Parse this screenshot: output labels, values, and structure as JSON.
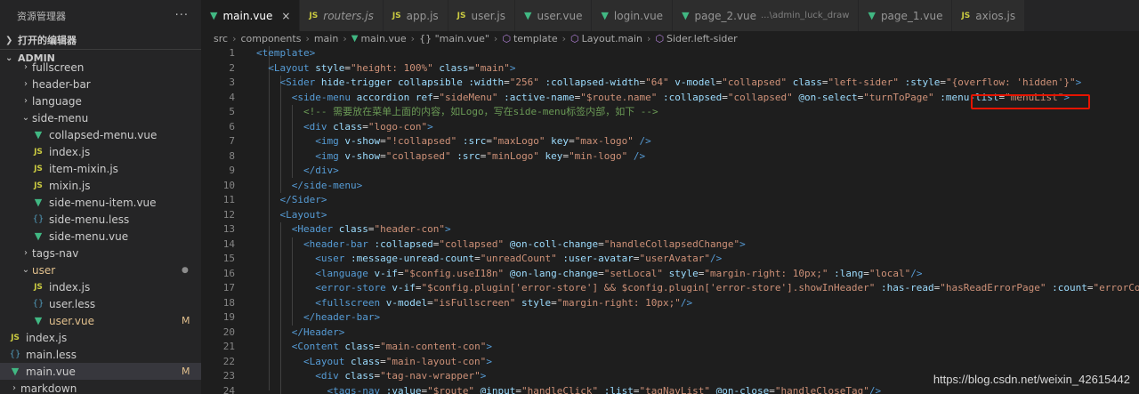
{
  "sidebar": {
    "title": "资源管理器",
    "more": "···",
    "open_editors": "打开的编辑器",
    "workspace": "ADMIN",
    "tree": [
      {
        "label": "fullscreen",
        "type": "folder",
        "depth": 2
      },
      {
        "label": "header-bar",
        "type": "folder",
        "depth": 2
      },
      {
        "label": "language",
        "type": "folder",
        "depth": 2
      },
      {
        "label": "side-menu",
        "type": "folder-open",
        "depth": 2
      },
      {
        "label": "collapsed-menu.vue",
        "type": "vue",
        "depth": 3
      },
      {
        "label": "index.js",
        "type": "js",
        "depth": 3
      },
      {
        "label": "item-mixin.js",
        "type": "js",
        "depth": 3
      },
      {
        "label": "mixin.js",
        "type": "js",
        "depth": 3
      },
      {
        "label": "side-menu-item.vue",
        "type": "vue",
        "depth": 3
      },
      {
        "label": "side-menu.less",
        "type": "less",
        "depth": 3
      },
      {
        "label": "side-menu.vue",
        "type": "vue",
        "depth": 3
      },
      {
        "label": "tags-nav",
        "type": "folder",
        "depth": 2
      },
      {
        "label": "user",
        "type": "folder-open",
        "depth": 2,
        "modified": true,
        "dot": "●"
      },
      {
        "label": "index.js",
        "type": "js",
        "depth": 3
      },
      {
        "label": "user.less",
        "type": "less",
        "depth": 3
      },
      {
        "label": "user.vue",
        "type": "vue",
        "depth": 3,
        "modified": true,
        "badge": "M"
      },
      {
        "label": "index.js",
        "type": "js",
        "depth": 1
      },
      {
        "label": "main.less",
        "type": "less",
        "depth": 1
      },
      {
        "label": "main.vue",
        "type": "vue",
        "depth": 1,
        "active": true,
        "badge": "M"
      },
      {
        "label": "markdown",
        "type": "folder",
        "depth": 1
      }
    ]
  },
  "tabs": [
    {
      "label": "main.vue",
      "icon": "vue",
      "active": true,
      "close": "×"
    },
    {
      "label": "routers.js",
      "icon": "js",
      "italic": true
    },
    {
      "label": "app.js",
      "icon": "js"
    },
    {
      "label": "user.js",
      "icon": "js"
    },
    {
      "label": "user.vue",
      "icon": "vue"
    },
    {
      "label": "login.vue",
      "icon": "vue"
    },
    {
      "label": "page_2.vue",
      "icon": "vue",
      "desc": "...\\admin_luck_draw"
    },
    {
      "label": "page_1.vue",
      "icon": "vue"
    },
    {
      "label": "axios.js",
      "icon": "js"
    }
  ],
  "breadcrumb": [
    "src",
    "components",
    "main",
    "main.vue",
    "{} \"main.vue\"",
    "template",
    "Layout.main",
    "Sider.left-sider"
  ],
  "code_lines": [
    [
      [
        "t",
        "<template>"
      ]
    ],
    [
      [
        "e",
        "  "
      ],
      [
        "t",
        "<Layout"
      ],
      [
        "a",
        " style"
      ],
      [
        "e",
        "="
      ],
      [
        "s",
        "\"height: 100%\""
      ],
      [
        "a",
        " class"
      ],
      [
        "e",
        "="
      ],
      [
        "s",
        "\"main\""
      ],
      [
        "t",
        ">"
      ]
    ],
    [
      [
        "e",
        "    "
      ],
      [
        "t",
        "<Sider"
      ],
      [
        "a",
        " hide-trigger collapsible :width"
      ],
      [
        "e",
        "="
      ],
      [
        "s",
        "\"256\""
      ],
      [
        "a",
        " :collapsed-width"
      ],
      [
        "e",
        "="
      ],
      [
        "s",
        "\"64\""
      ],
      [
        "a",
        " v-model"
      ],
      [
        "e",
        "="
      ],
      [
        "s",
        "\"collapsed\""
      ],
      [
        "a",
        " class"
      ],
      [
        "e",
        "="
      ],
      [
        "s",
        "\"left-sider\""
      ],
      [
        "a",
        " :style"
      ],
      [
        "e",
        "="
      ],
      [
        "s",
        "\"{overflow: 'hidden'}\""
      ],
      [
        "t",
        ">"
      ]
    ],
    [
      [
        "e",
        "      "
      ],
      [
        "t",
        "<side-menu"
      ],
      [
        "a",
        " accordion ref"
      ],
      [
        "e",
        "="
      ],
      [
        "s",
        "\"sideMenu\""
      ],
      [
        "a",
        " :active-name"
      ],
      [
        "e",
        "="
      ],
      [
        "s",
        "\"$route.name\""
      ],
      [
        "a",
        " :collapsed"
      ],
      [
        "e",
        "="
      ],
      [
        "s",
        "\"collapsed\""
      ],
      [
        "a",
        " @on-select"
      ],
      [
        "e",
        "="
      ],
      [
        "s",
        "\"turnToPage\""
      ],
      [
        "a",
        " :menu-list"
      ],
      [
        "e",
        "="
      ],
      [
        "s",
        "\"menuList\""
      ],
      [
        "t",
        ">"
      ]
    ],
    [
      [
        "e",
        "        "
      ],
      [
        "c",
        "<!-- 需要放在菜单上面的内容，如Logo，写在side-menu标签内部，如下 -->"
      ]
    ],
    [
      [
        "e",
        "        "
      ],
      [
        "t",
        "<div"
      ],
      [
        "a",
        " class"
      ],
      [
        "e",
        "="
      ],
      [
        "s",
        "\"logo-con\""
      ],
      [
        "t",
        ">"
      ]
    ],
    [
      [
        "e",
        "          "
      ],
      [
        "t",
        "<img"
      ],
      [
        "a",
        " v-show"
      ],
      [
        "e",
        "="
      ],
      [
        "s",
        "\"!collapsed\""
      ],
      [
        "a",
        " :src"
      ],
      [
        "e",
        "="
      ],
      [
        "s",
        "\"maxLogo\""
      ],
      [
        "a",
        " key"
      ],
      [
        "e",
        "="
      ],
      [
        "s",
        "\"max-logo\""
      ],
      [
        "t",
        " />"
      ]
    ],
    [
      [
        "e",
        "          "
      ],
      [
        "t",
        "<img"
      ],
      [
        "a",
        " v-show"
      ],
      [
        "e",
        "="
      ],
      [
        "s",
        "\"collapsed\""
      ],
      [
        "a",
        " :src"
      ],
      [
        "e",
        "="
      ],
      [
        "s",
        "\"minLogo\""
      ],
      [
        "a",
        " key"
      ],
      [
        "e",
        "="
      ],
      [
        "s",
        "\"min-logo\""
      ],
      [
        "t",
        " />"
      ]
    ],
    [
      [
        "e",
        "        "
      ],
      [
        "t",
        "</div>"
      ]
    ],
    [
      [
        "e",
        "      "
      ],
      [
        "t",
        "</side-menu>"
      ]
    ],
    [
      [
        "e",
        "    "
      ],
      [
        "t",
        "</Sider>"
      ]
    ],
    [
      [
        "e",
        "    "
      ],
      [
        "t",
        "<Layout>"
      ]
    ],
    [
      [
        "e",
        "      "
      ],
      [
        "t",
        "<Header"
      ],
      [
        "a",
        " class"
      ],
      [
        "e",
        "="
      ],
      [
        "s",
        "\"header-con\""
      ],
      [
        "t",
        ">"
      ]
    ],
    [
      [
        "e",
        "        "
      ],
      [
        "t",
        "<header-bar"
      ],
      [
        "a",
        " :collapsed"
      ],
      [
        "e",
        "="
      ],
      [
        "s",
        "\"collapsed\""
      ],
      [
        "a",
        " @on-coll-change"
      ],
      [
        "e",
        "="
      ],
      [
        "s",
        "\"handleCollapsedChange\""
      ],
      [
        "t",
        ">"
      ]
    ],
    [
      [
        "e",
        "          "
      ],
      [
        "t",
        "<user"
      ],
      [
        "a",
        " :message-unread-count"
      ],
      [
        "e",
        "="
      ],
      [
        "s",
        "\"unreadCount\""
      ],
      [
        "a",
        " :user-avatar"
      ],
      [
        "e",
        "="
      ],
      [
        "s",
        "\"userAvatar\""
      ],
      [
        "t",
        "/>"
      ]
    ],
    [
      [
        "e",
        "          "
      ],
      [
        "t",
        "<language"
      ],
      [
        "a",
        " v-if"
      ],
      [
        "e",
        "="
      ],
      [
        "s",
        "\"$config.useI18n\""
      ],
      [
        "a",
        " @on-lang-change"
      ],
      [
        "e",
        "="
      ],
      [
        "s",
        "\"setLocal\""
      ],
      [
        "a",
        " style"
      ],
      [
        "e",
        "="
      ],
      [
        "s",
        "\"margin-right: 10px;\""
      ],
      [
        "a",
        " :lang"
      ],
      [
        "e",
        "="
      ],
      [
        "s",
        "\"local\""
      ],
      [
        "t",
        "/>"
      ]
    ],
    [
      [
        "e",
        "          "
      ],
      [
        "t",
        "<error-store"
      ],
      [
        "a",
        " v-if"
      ],
      [
        "e",
        "="
      ],
      [
        "s",
        "\"$config.plugin['error-store'] && $config.plugin['error-store'].showInHeader\""
      ],
      [
        "a",
        " :has-read"
      ],
      [
        "e",
        "="
      ],
      [
        "s",
        "\"hasReadErrorPage\""
      ],
      [
        "a",
        " :count"
      ],
      [
        "e",
        "="
      ],
      [
        "s",
        "\"errorCount\""
      ]
    ],
    [
      [
        "e",
        "          "
      ],
      [
        "t",
        "<fullscreen"
      ],
      [
        "a",
        " v-model"
      ],
      [
        "e",
        "="
      ],
      [
        "s",
        "\"isFullscreen\""
      ],
      [
        "a",
        " style"
      ],
      [
        "e",
        "="
      ],
      [
        "s",
        "\"margin-right: 10px;\""
      ],
      [
        "t",
        "/>"
      ]
    ],
    [
      [
        "e",
        "        "
      ],
      [
        "t",
        "</header-bar>"
      ]
    ],
    [
      [
        "e",
        "      "
      ],
      [
        "t",
        "</Header>"
      ]
    ],
    [
      [
        "e",
        "      "
      ],
      [
        "t",
        "<Content"
      ],
      [
        "a",
        " class"
      ],
      [
        "e",
        "="
      ],
      [
        "s",
        "\"main-content-con\""
      ],
      [
        "t",
        ">"
      ]
    ],
    [
      [
        "e",
        "        "
      ],
      [
        "t",
        "<Layout"
      ],
      [
        "a",
        " class"
      ],
      [
        "e",
        "="
      ],
      [
        "s",
        "\"main-layout-con\""
      ],
      [
        "t",
        ">"
      ]
    ],
    [
      [
        "e",
        "          "
      ],
      [
        "t",
        "<div"
      ],
      [
        "a",
        " class"
      ],
      [
        "e",
        "="
      ],
      [
        "s",
        "\"tag-nav-wrapper\""
      ],
      [
        "t",
        ">"
      ]
    ],
    [
      [
        "e",
        "            "
      ],
      [
        "t",
        "<tags-nav"
      ],
      [
        "a",
        " :value"
      ],
      [
        "e",
        "="
      ],
      [
        "s",
        "\"$route\""
      ],
      [
        "a",
        " @input"
      ],
      [
        "e",
        "="
      ],
      [
        "s",
        "\"handleClick\""
      ],
      [
        "a",
        " :list"
      ],
      [
        "e",
        "="
      ],
      [
        "s",
        "\"tagNavList\""
      ],
      [
        "a",
        " @on-close"
      ],
      [
        "e",
        "="
      ],
      [
        "s",
        "\"handleCloseTag\""
      ],
      [
        "t",
        "/>"
      ]
    ]
  ],
  "watermark": "https://blog.csdn.net/weixin_42615442",
  "colors": {
    "vue": "#41b883",
    "js": "#cbcb41",
    "less": "#519aba",
    "highlight": "#e51400"
  }
}
